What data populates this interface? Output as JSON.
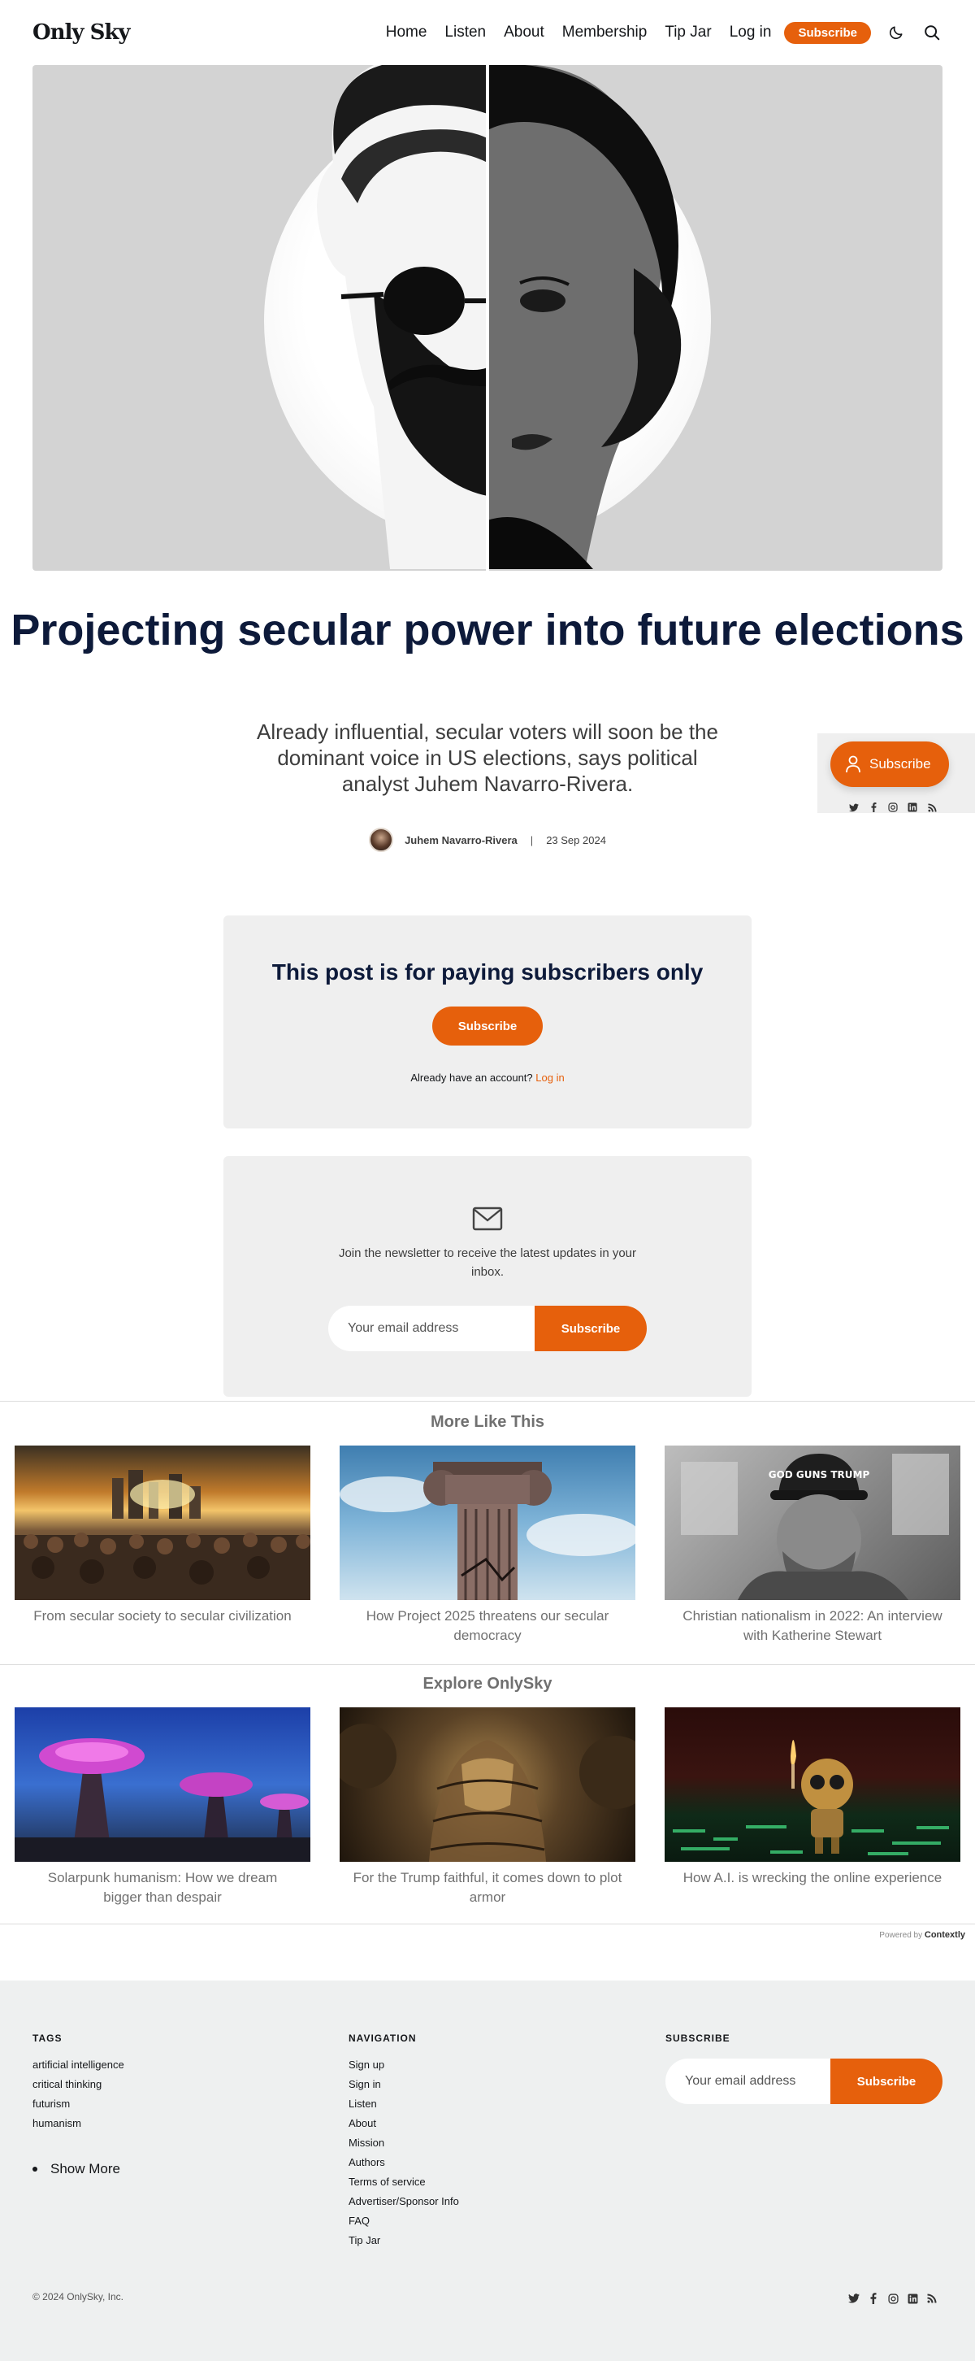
{
  "site": {
    "logo": "Only Sky"
  },
  "nav": {
    "items": [
      "Home",
      "Listen",
      "About",
      "Membership",
      "Tip Jar",
      "Log in"
    ],
    "subscribe_label": "Subscribe"
  },
  "article": {
    "title": "Projecting secular power into future elections",
    "excerpt": "Already influential, secular voters will soon be the dominant voice in US elections, says political analyst Juhem Navarro-Rivera.",
    "author": "Juhem Navarro-Rivera",
    "separator": "|",
    "date": "23 Sep 2024"
  },
  "floating": {
    "subscribe_label": "Subscribe"
  },
  "paywall": {
    "heading": "This post is for paying subscribers only",
    "button": "Subscribe",
    "account_text": "Already have an account?",
    "login_link": "Log in"
  },
  "newsletter": {
    "text": "Join the newsletter to receive the latest updates in your inbox.",
    "placeholder": "Your email address",
    "button": "Subscribe"
  },
  "more_like_this": {
    "title": "More Like This",
    "items": [
      {
        "caption": "From secular society to secular civilization"
      },
      {
        "caption": "How Project 2025 threatens our secular democracy"
      },
      {
        "caption": "Christian nationalism in 2022: An interview with Katherine Stewart"
      }
    ]
  },
  "explore": {
    "title": "Explore OnlySky",
    "items": [
      {
        "caption": "Solarpunk humanism: How we dream bigger than despair"
      },
      {
        "caption": "For the Trump faithful, it comes down to plot armor"
      },
      {
        "caption": "How A.I. is wrecking the online experience"
      }
    ]
  },
  "hat_text": "GOD GUNS TRUMP",
  "powered": {
    "prefix": "Powered by",
    "brand": "Contextly"
  },
  "footer": {
    "tags_heading": "TAGS",
    "tags": [
      "artificial intelligence",
      "critical thinking",
      "futurism",
      "humanism"
    ],
    "show_more": "Show More",
    "nav_heading": "NAVIGATION",
    "nav_links": [
      "Sign up",
      "Sign in",
      "Listen",
      "About",
      "Mission",
      "Authors",
      "Terms of service",
      "Advertiser/Sponsor Info",
      "FAQ",
      "Tip Jar"
    ],
    "subscribe_heading": "SUBSCRIBE",
    "email_placeholder": "Your email address",
    "subscribe_button": "Subscribe",
    "copyright": "© 2024 OnlySky, Inc."
  },
  "colors": {
    "accent": "#e6600c",
    "title": "#0d1a3a",
    "panel": "#efefef",
    "footer": "#eef0f0"
  },
  "icons": [
    "moon-icon",
    "search-icon",
    "person-icon",
    "envelope-icon",
    "twitter-icon",
    "facebook-icon",
    "instagram-icon",
    "linkedin-icon",
    "rss-icon"
  ]
}
